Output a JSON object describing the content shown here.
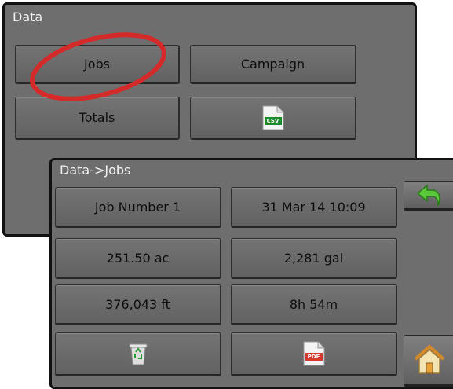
{
  "data_screen": {
    "title": "Data",
    "buttons": {
      "jobs": "Jobs",
      "campaign": "Campaign",
      "totals": "Totals",
      "csv_tag": "CSV"
    },
    "highlight_color": "#d42a2a"
  },
  "jobs_screen": {
    "title": "Data->Jobs",
    "fields": {
      "job_name": "Job Number 1",
      "date_time": "31 Mar 14 10:09",
      "area": "251.50 ac",
      "volume": "2,281 gal",
      "distance": "376,043 ft",
      "duration": "8h 54m"
    },
    "pdf_tag": "PDF",
    "icons": {
      "delete": "recycle-bin-icon",
      "export": "pdf-file-icon",
      "back": "back-arrow-icon",
      "home": "home-icon"
    }
  }
}
